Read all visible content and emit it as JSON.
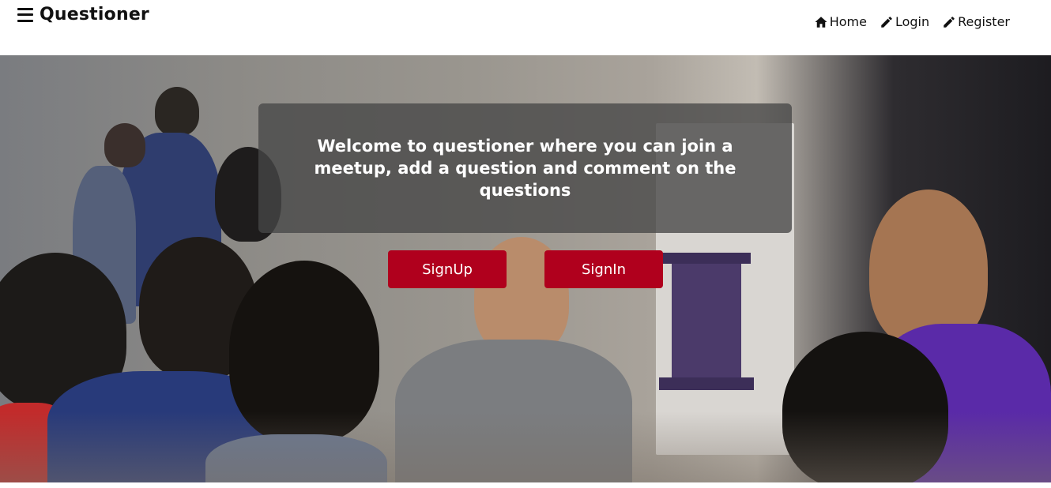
{
  "header": {
    "brand_title": "Questioner",
    "menu_icon": "hamburger-menu-icon"
  },
  "nav": {
    "items": [
      {
        "label": "Home",
        "icon": "home-icon"
      },
      {
        "label": "Login",
        "icon": "pencil-icon"
      },
      {
        "label": "Register",
        "icon": "pencil-icon"
      }
    ]
  },
  "hero": {
    "welcome_text": "Welcome to questioner where you can join a meetup, add a question and comment on the questions",
    "signup_label": "SignUp",
    "signin_label": "SignIn"
  },
  "colors": {
    "button_bg": "#b0001d",
    "overlay_bg": "#464646",
    "text_on_dark": "#ffffff"
  }
}
